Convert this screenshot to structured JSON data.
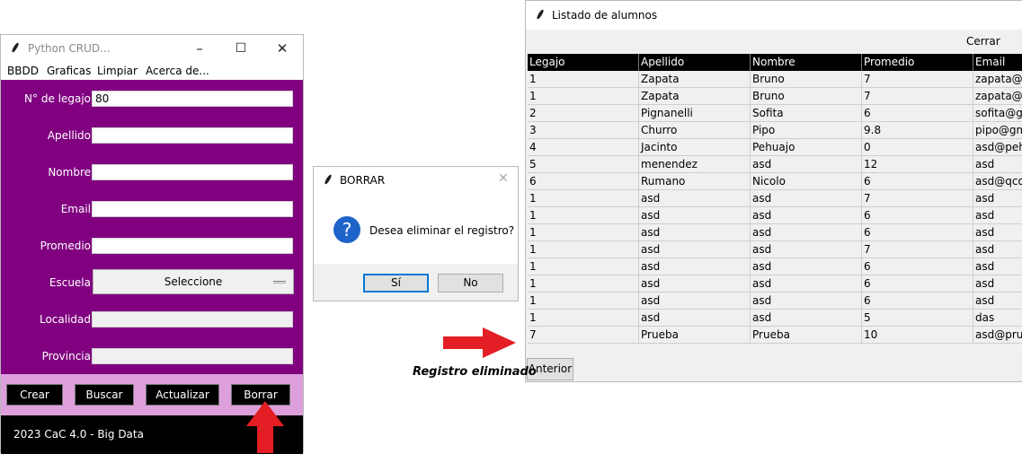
{
  "crud_window": {
    "title": "Python CRUD...",
    "menu": [
      "BBDD",
      "Graficas",
      "Limpiar",
      "Acerca de..."
    ],
    "fields": {
      "legajo": {
        "label": "N° de legajo",
        "value": "80"
      },
      "apellido": {
        "label": "Apellido",
        "value": ""
      },
      "nombre": {
        "label": "Nombre",
        "value": ""
      },
      "email": {
        "label": "Email",
        "value": ""
      },
      "promedio": {
        "label": "Promedio",
        "value": ""
      },
      "escuela": {
        "label": "Escuela",
        "value": "Seleccione"
      },
      "localidad": {
        "label": "Localidad",
        "value": ""
      },
      "provincia": {
        "label": "Provincia",
        "value": ""
      }
    },
    "buttons": [
      "Crear",
      "Buscar",
      "Actualizar",
      "Borrar"
    ],
    "footer": "2023  CaC 4.0 - Big Data",
    "colors": {
      "form_bg": "#800080",
      "button_bar_bg": "#dda0dd",
      "footer_bg": "#000000"
    }
  },
  "dialog": {
    "title": "BORRAR",
    "message": "Desea eliminar el registro?",
    "yes": "Sí",
    "no": "No",
    "icon": "question-icon"
  },
  "list_window": {
    "title": "Listado de alumnos",
    "close_label": "Cerrar",
    "prev_label": "Anterior",
    "columns": [
      "Legajo",
      "Apellido",
      "Nombre",
      "Promedio",
      "Email"
    ],
    "rows": [
      [
        "1",
        "Zapata",
        "Bruno",
        "7",
        "zapata@a"
      ],
      [
        "1",
        "Zapata",
        "Bruno",
        "7",
        "zapata@a"
      ],
      [
        "2",
        "Pignanelli",
        "Sofita",
        "6",
        "sofita@g"
      ],
      [
        "3",
        "Churro",
        "Pipo",
        "9.8",
        "pipo@gm"
      ],
      [
        "4",
        "Jacinto",
        "Pehuajo",
        "0",
        "asd@peh"
      ],
      [
        "5",
        "menendez",
        "asd",
        "12",
        "asd"
      ],
      [
        "6",
        "Rumano",
        "Nicolo",
        "6",
        "asd@qco"
      ],
      [
        "1",
        "asd",
        "asd",
        "7",
        "asd"
      ],
      [
        "1",
        "asd",
        "asd",
        "6",
        "asd"
      ],
      [
        "1",
        "asd",
        "asd",
        "6",
        "asd"
      ],
      [
        "1",
        "asd",
        "asd",
        "7",
        "asd"
      ],
      [
        "1",
        "asd",
        "asd",
        "6",
        "asd"
      ],
      [
        "1",
        "asd",
        "asd",
        "6",
        "asd"
      ],
      [
        "1",
        "asd",
        "asd",
        "6",
        "asd"
      ],
      [
        "1",
        "asd",
        "asd",
        "5",
        "das"
      ],
      [
        "7",
        "Prueba",
        "Prueba",
        "10",
        "asd@pru"
      ]
    ]
  },
  "annotation": {
    "caption": "Registro eliminado",
    "arrow_color": "#e31e24"
  }
}
